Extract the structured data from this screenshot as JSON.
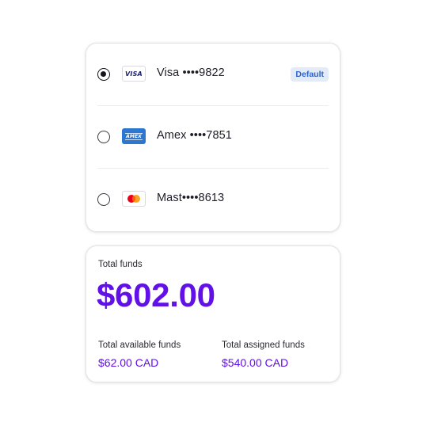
{
  "payment_methods": [
    {
      "brand_icon": "visa-card-icon",
      "label": "Visa ••••9822",
      "selected": true,
      "badge": "Default"
    },
    {
      "brand_icon": "amex-card-icon",
      "label": "Amex ••••7851",
      "selected": false
    },
    {
      "brand_icon": "mastercard-icon",
      "label": "Mast••••8613",
      "selected": false
    }
  ],
  "icons": {
    "visa_text": "VISA",
    "amex_text": "AMEX"
  },
  "funds": {
    "title": "Total funds",
    "total": "$602.00",
    "available_label": "Total available funds",
    "available_value": "$62.00 CAD",
    "assigned_label": "Total assigned funds",
    "assigned_value": "$540.00 CAD"
  },
  "colors": {
    "accent": "#6110e8",
    "badge_bg": "#e3ebf8",
    "badge_text": "#2f63c8",
    "amex_blue": "#2e77d0",
    "mastercard_red": "#eb001b",
    "mastercard_orange": "#f79e1b"
  }
}
